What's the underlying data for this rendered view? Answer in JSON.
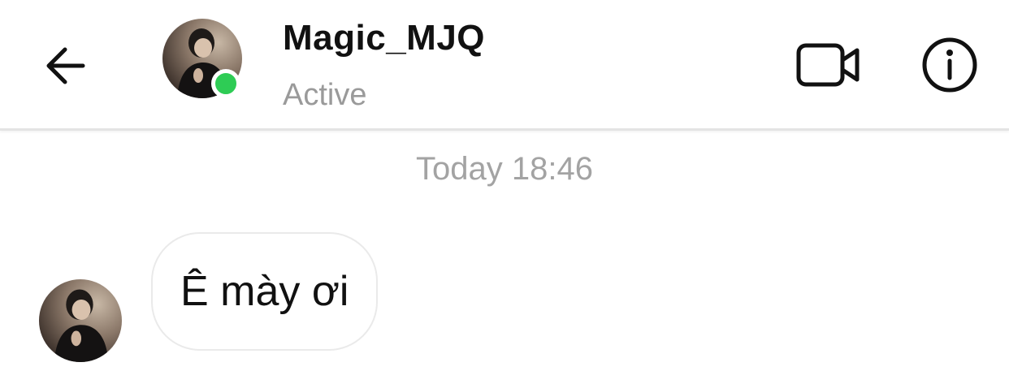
{
  "header": {
    "username": "Magic_MJQ",
    "status": "Active",
    "status_color": "#2ecc55"
  },
  "icons": {
    "back": "arrow-left-icon",
    "video": "video-camera-icon",
    "info": "info-circle-icon"
  },
  "conversation": {
    "timestamp": "Today 18:46",
    "messages": [
      {
        "sender": "Magic_MJQ",
        "text": "Ê mày ơi"
      }
    ]
  }
}
